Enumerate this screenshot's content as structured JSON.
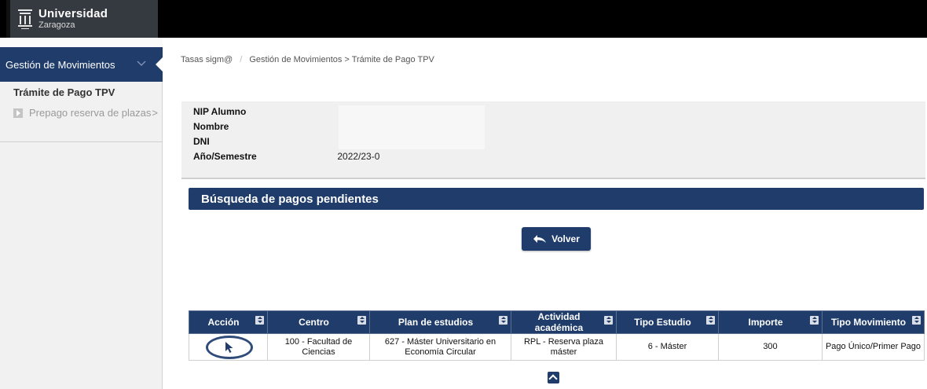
{
  "header": {
    "logo_line1": "Universidad",
    "logo_line2": "Zaragoza"
  },
  "sidebar": {
    "menu_title": "Gestión de Movimientos",
    "section_title": "Trámite de Pago TPV",
    "items": [
      {
        "label": "Prepago reserva de plazas",
        "icon": "play-square-icon"
      }
    ],
    "item_arrow": ">"
  },
  "breadcrumb": {
    "root": "Tasas sigm@",
    "separator": "/",
    "path": "Gestión de Movimientos > Trámite de Pago TPV"
  },
  "student_info": {
    "nip_label": "NIP Alumno",
    "nip_value": "",
    "nombre_label": "Nombre",
    "nombre_value": "",
    "dni_label": "DNI",
    "dni_value": "",
    "anio_label": "Año/Semestre",
    "anio_value": "2022/23-0"
  },
  "search_section": {
    "title": "Búsqueda de pagos pendientes"
  },
  "buttons": {
    "volver": "Volver"
  },
  "table": {
    "columns": [
      "Acción",
      "Centro",
      "Plan de estudios",
      "Actividad académica",
      "Tipo Estudio",
      "Importe",
      "Tipo Movimiento"
    ],
    "rows": [
      {
        "accion": "",
        "centro": "100 - Facultad de Ciencias",
        "plan_line1": "627 - Máster Universitario en",
        "plan_line2": "Economía Circular",
        "actividad": "RPL - Reserva plaza máster",
        "tipo_estudio": "6 - Máster",
        "importe": "300",
        "tipo_movimiento": "Pago Único/Primer Pago"
      }
    ]
  },
  "colors": {
    "primary_navy": "#1f3c6b",
    "header_black": "#000000",
    "sidebar_bg": "#f1f1f1",
    "panel_bg": "#f0f0f0"
  }
}
